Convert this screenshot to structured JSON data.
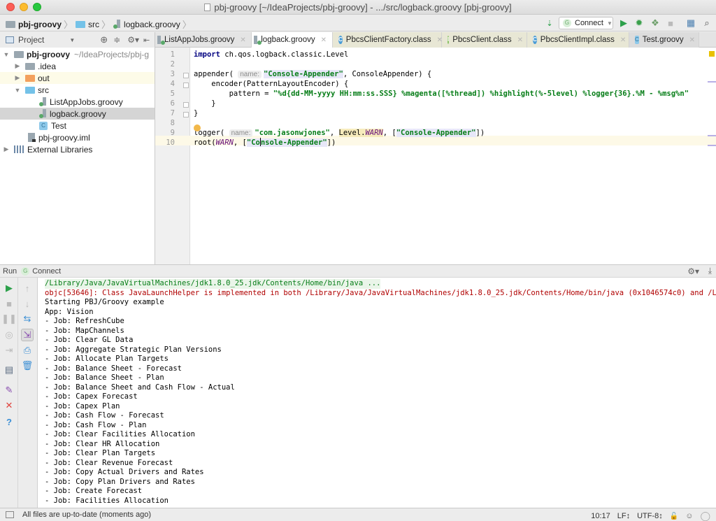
{
  "window": {
    "title": "pbj-groovy [~/IdeaProjects/pbj-groovy] - .../src/logback.groovy [pbj-groovy]"
  },
  "breadcrumb": {
    "items": [
      "pbj-groovy",
      "src",
      "logback.groovy"
    ]
  },
  "toolbar": {
    "run_config": "Connect",
    "run_config_badge": "G"
  },
  "project_panel": {
    "title": "Project",
    "tree": [
      {
        "label": "pbj-groovy",
        "path": "~/IdeaProjects/pbj-g",
        "type": "module",
        "expanded": true,
        "level": 0
      },
      {
        "label": ".idea",
        "type": "folder",
        "expanded": false,
        "level": 1
      },
      {
        "label": "out",
        "type": "folder-excluded",
        "expanded": false,
        "level": 1
      },
      {
        "label": "src",
        "type": "folder-source",
        "expanded": true,
        "level": 1
      },
      {
        "label": "ListAppJobs.groovy",
        "type": "groovy",
        "level": 2
      },
      {
        "label": "logback.groovy",
        "type": "groovy",
        "level": 2,
        "selected": true
      },
      {
        "label": "Test",
        "type": "class",
        "level": 2
      },
      {
        "label": "pbj-groovy.iml",
        "type": "iml",
        "level": 1
      },
      {
        "label": "External Libraries",
        "type": "libraries",
        "expanded": false,
        "level": 0
      }
    ]
  },
  "editor_tabs": [
    {
      "label": "ListAppJobs.groovy",
      "icon": "groovy-file-icon",
      "active": false
    },
    {
      "label": "logback.groovy",
      "icon": "groovy-file-icon",
      "active": true
    },
    {
      "label": "PbcsClientFactory.class",
      "icon": "class-icon",
      "active": false
    },
    {
      "label": "PbcsClient.class",
      "icon": "interface-icon",
      "active": false
    },
    {
      "label": "PbcsClientImpl.class",
      "icon": "class-icon",
      "active": false
    },
    {
      "label": "Test.groovy",
      "icon": "groovy-class-icon",
      "active": false
    }
  ],
  "editor": {
    "line_numbers": [
      "1",
      "2",
      "3",
      "4",
      "5",
      "6",
      "7",
      "8",
      "9",
      "10"
    ],
    "lines": {
      "l1_kw": "import",
      "l1_rest": " ch.qos.logback.classic.Level",
      "l3_a": "appender( ",
      "l3_hint": "name:",
      "l3_str": "\"Console-Appender\"",
      "l3_b": ", ConsoleAppender) {",
      "l4": "    encoder(PatternLayoutEncoder) {",
      "l5_a": "        pattern = ",
      "l5_str": "\"%d{dd-MM-yyyy HH:mm:ss.SSS} %magenta([%thread]) %highlight(%-5level) %logger{36}.%M - %msg%n\"",
      "l6": "    }",
      "l7": "}",
      "l9_a": "logger( ",
      "l9_hint": "name:",
      "l9_str": "\"com.jasonwjones\"",
      "l9_b": ", ",
      "l9_level": "Level.",
      "l9_warn": "WARN",
      "l9_c": ", [",
      "l9_str2": "\"Console-Appender\"",
      "l9_d": "])",
      "l10_a": "root(",
      "l10_warn": "WARN",
      "l10_b": ", [",
      "l10_str_a": "\"Co",
      "l10_str_b": "nsole-Appender\"",
      "l10_c": "])"
    }
  },
  "run_panel": {
    "label": "Run",
    "config": "Connect",
    "console": [
      {
        "text": "/Library/Java/JavaVirtualMachines/jdk1.8.0_25.jdk/Contents/Home/bin/java ...",
        "kind": "cmd"
      },
      {
        "text": "objc[53646]: Class JavaLaunchHelper is implemented in both /Library/Java/JavaVirtualMachines/jdk1.8.0_25.jdk/Contents/Home/bin/java (0x1046574c0) and /L",
        "kind": "err"
      },
      {
        "text": "Starting PBJ/Groovy example",
        "kind": "out"
      },
      {
        "text": "App: Vision",
        "kind": "out"
      },
      {
        "text": "- Job: RefreshCube",
        "kind": "out"
      },
      {
        "text": "- Job: MapChannels",
        "kind": "out"
      },
      {
        "text": "- Job: Clear GL Data",
        "kind": "out"
      },
      {
        "text": "- Job: Aggregate Strategic Plan Versions",
        "kind": "out"
      },
      {
        "text": "- Job: Allocate Plan Targets",
        "kind": "out"
      },
      {
        "text": "- Job: Balance Sheet - Forecast",
        "kind": "out"
      },
      {
        "text": "- Job: Balance Sheet - Plan",
        "kind": "out"
      },
      {
        "text": "- Job: Balance Sheet and Cash Flow - Actual",
        "kind": "out"
      },
      {
        "text": "- Job: Capex Forecast",
        "kind": "out"
      },
      {
        "text": "- Job: Capex Plan",
        "kind": "out"
      },
      {
        "text": "- Job: Cash Flow - Forecast",
        "kind": "out"
      },
      {
        "text": "- Job: Cash Flow - Plan",
        "kind": "out"
      },
      {
        "text": "- Job: Clear Facilities Allocation",
        "kind": "out"
      },
      {
        "text": "- Job: Clear HR Allocation",
        "kind": "out"
      },
      {
        "text": "- Job: Clear Plan Targets",
        "kind": "out"
      },
      {
        "text": "- Job: Clear Revenue Forecast",
        "kind": "out"
      },
      {
        "text": "- Job: Copy Actual Drivers and Rates",
        "kind": "out"
      },
      {
        "text": "- Job: Copy Plan Drivers and Rates",
        "kind": "out"
      },
      {
        "text": "- Job: Create Forecast",
        "kind": "out"
      },
      {
        "text": "- Job: Facilities Allocation",
        "kind": "out"
      }
    ]
  },
  "status_bar": {
    "message": "All files are up-to-date (moments ago)",
    "position": "10:17",
    "line_separator": "LF↕",
    "encoding": "UTF-8↕"
  },
  "colors": {
    "run_green": "#2ca04a",
    "string_green": "#067d17",
    "error_red": "#b00000",
    "close_red": "#e0443e",
    "help_blue": "#3b8fd5"
  }
}
